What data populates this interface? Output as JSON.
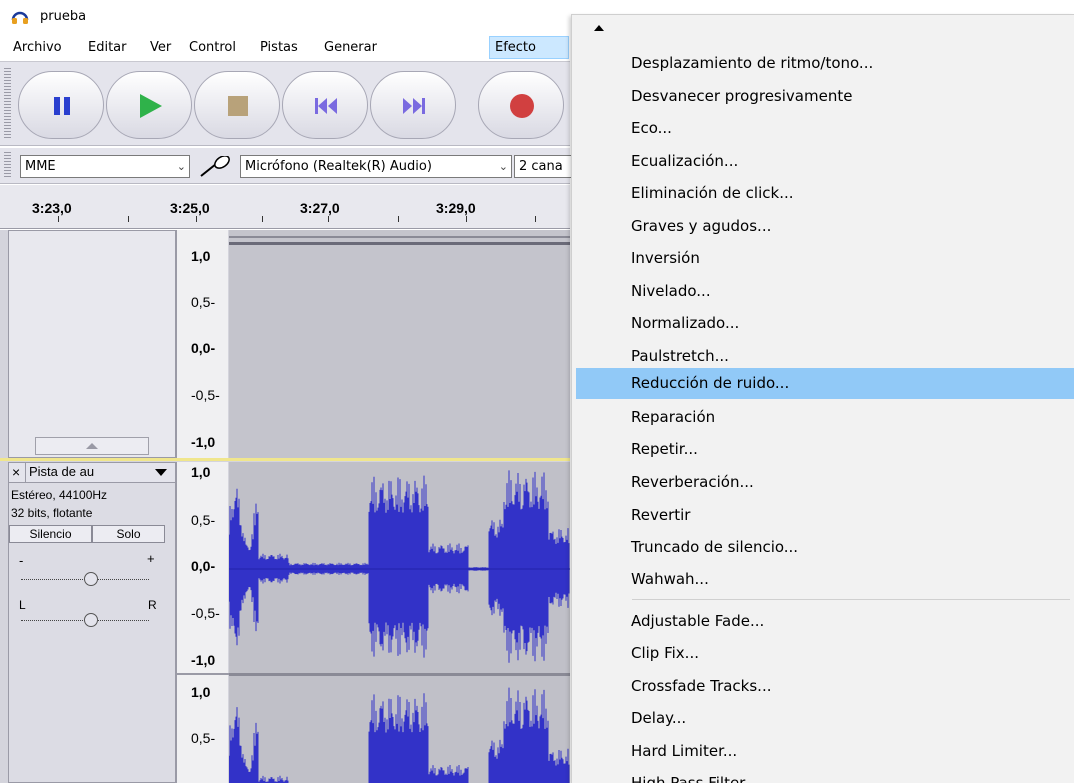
{
  "window": {
    "title": "prueba"
  },
  "menubar": [
    {
      "label": "Archivo"
    },
    {
      "label": "Editar"
    },
    {
      "label": "Ver"
    },
    {
      "label": "Control"
    },
    {
      "label": "Pistas"
    },
    {
      "label": "Generar"
    },
    {
      "label": "Efecto",
      "active": true
    }
  ],
  "transport": {
    "buttons": [
      "pause-icon",
      "play-icon",
      "stop-icon",
      "skip-start-icon",
      "skip-end-icon",
      "record-icon"
    ],
    "colors": {
      "pause": "#2a3fcf",
      "play": "#2fb24a",
      "stop": "#b8a27a",
      "skip": "#7a6ae0",
      "record": "#d14040"
    }
  },
  "devicebar": {
    "host": "MME",
    "input_device": "Micrófono (Realtek(R) Audio)",
    "channels": "2 cana"
  },
  "timeline": {
    "labels": [
      "3:23,0",
      "3:25,0",
      "3:27,0",
      "3:29,0"
    ]
  },
  "track1": {
    "scale": [
      "1,0",
      "0,5-",
      "0,0-",
      "-0,5-",
      "-1,0"
    ],
    "collapse_icon": "triangle-up-icon"
  },
  "track2": {
    "name": "Pista de au",
    "format": "Estéreo, 44100Hz",
    "bits": "32 bits, flotante",
    "mute_label": "Silencio",
    "solo_label": "Solo",
    "gain_minus": "-",
    "gain_plus": "+",
    "pan_left": "L",
    "pan_right": "R",
    "scale_left": [
      "1,0",
      "0,5-",
      "0,0-",
      "-0,5-",
      "-1,0"
    ],
    "scale_right": [
      "1,0",
      "0,5-"
    ],
    "wave_color": "#3232c8"
  },
  "effect_menu": {
    "items": [
      "Desplazamiento de ritmo/tono...",
      "Desvanecer progresivamente",
      "Eco...",
      "Ecualización...",
      "Eliminación de click...",
      "Graves y agudos...",
      "Inversión",
      "Nivelado...",
      "Normalizado...",
      "Paulstretch...",
      "Reducción de ruido...",
      "Reparación",
      "Repetir...",
      "Reverberación...",
      "Revertir",
      "Truncado de silencio...",
      "Wahwah..."
    ],
    "highlighted": "Reducción de ruido...",
    "items_extra": [
      "Adjustable Fade...",
      "Clip Fix...",
      "Crossfade Tracks...",
      "Delay...",
      "Hard Limiter...",
      "High Pass Filter..."
    ],
    "highlight_color": "#91c9f7"
  }
}
